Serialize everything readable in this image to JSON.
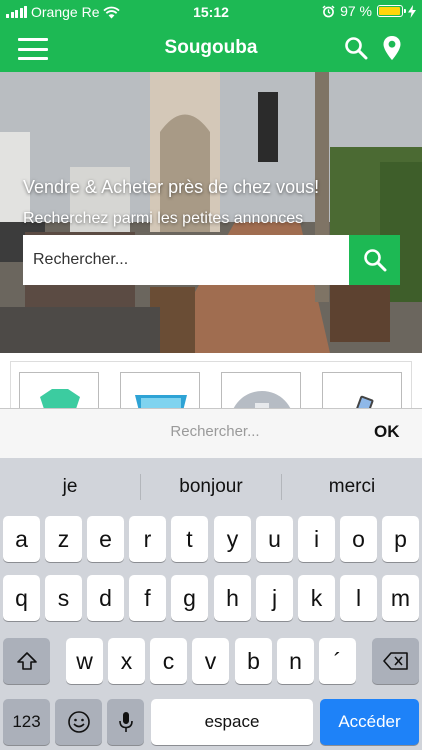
{
  "status": {
    "carrier": "Orange Re",
    "time": "15:12",
    "battery_percent": "97 %",
    "battery_level": 0.97
  },
  "header": {
    "title": "Sougouba"
  },
  "hero": {
    "headline": "Vendre & Acheter près de chez vous!",
    "subline": "Recherchez parmi les petites annonces",
    "search_placeholder": "Rechercher..."
  },
  "accessory": {
    "input_placeholder": "Rechercher...",
    "ok_label": "OK"
  },
  "keyboard": {
    "suggestions": [
      "je",
      "bonjour",
      "merci"
    ],
    "row1": [
      "a",
      "z",
      "e",
      "r",
      "t",
      "y",
      "u",
      "i",
      "o",
      "p"
    ],
    "row2": [
      "q",
      "s",
      "d",
      "f",
      "g",
      "h",
      "j",
      "k",
      "l",
      "m"
    ],
    "row3": [
      "w",
      "x",
      "c",
      "v",
      "b",
      "n",
      "´"
    ],
    "numbers_label": "123",
    "space_label": "espace",
    "return_label": "Accéder"
  },
  "colors": {
    "brand_green": "#1db954",
    "keyboard_bg": "#d1d4da",
    "return_blue": "#1e82f8"
  }
}
